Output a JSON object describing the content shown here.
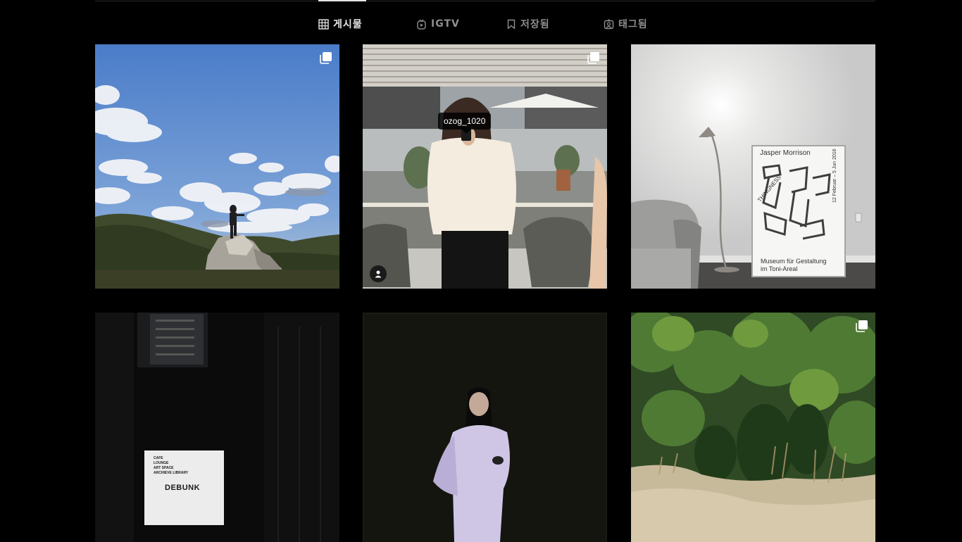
{
  "tabs": [
    {
      "label": "게시물",
      "icon": "grid-icon",
      "active": true
    },
    {
      "label": "IGTV",
      "icon": "igtv-icon",
      "active": false
    },
    {
      "label": "저장됨",
      "icon": "bookmark-icon",
      "active": false
    },
    {
      "label": "태그됨",
      "icon": "tagged-icon",
      "active": false
    }
  ],
  "posts": [
    {
      "scene": "sky-rocks",
      "multiple": true
    },
    {
      "scene": "mirror-selfie",
      "multiple": true,
      "tagged_user": "ozog_1020"
    },
    {
      "scene": "lamp-poster",
      "multiple": false,
      "poster": {
        "author": "Jasper Morrison",
        "title": "THINGNESS",
        "dates": "12 Februar – 5 Jun 2016",
        "venue_line1": "Museum für Gestaltung",
        "venue_line2": "im Toni-Areal"
      }
    },
    {
      "scene": "debunk-sign",
      "multiple": false,
      "sign": {
        "lines": [
          "CAFE",
          "LOUNGE",
          "ART SPACE",
          "ARCHIEVE LIBRARY"
        ],
        "brand": "DEBUNK"
      }
    },
    {
      "scene": "night-portrait",
      "multiple": false
    },
    {
      "scene": "forest-cliff",
      "multiple": true
    }
  ],
  "colors": {
    "active_tab": "#e6e6e6",
    "inactive_tab": "#8e8e8e",
    "background": "#000000"
  }
}
